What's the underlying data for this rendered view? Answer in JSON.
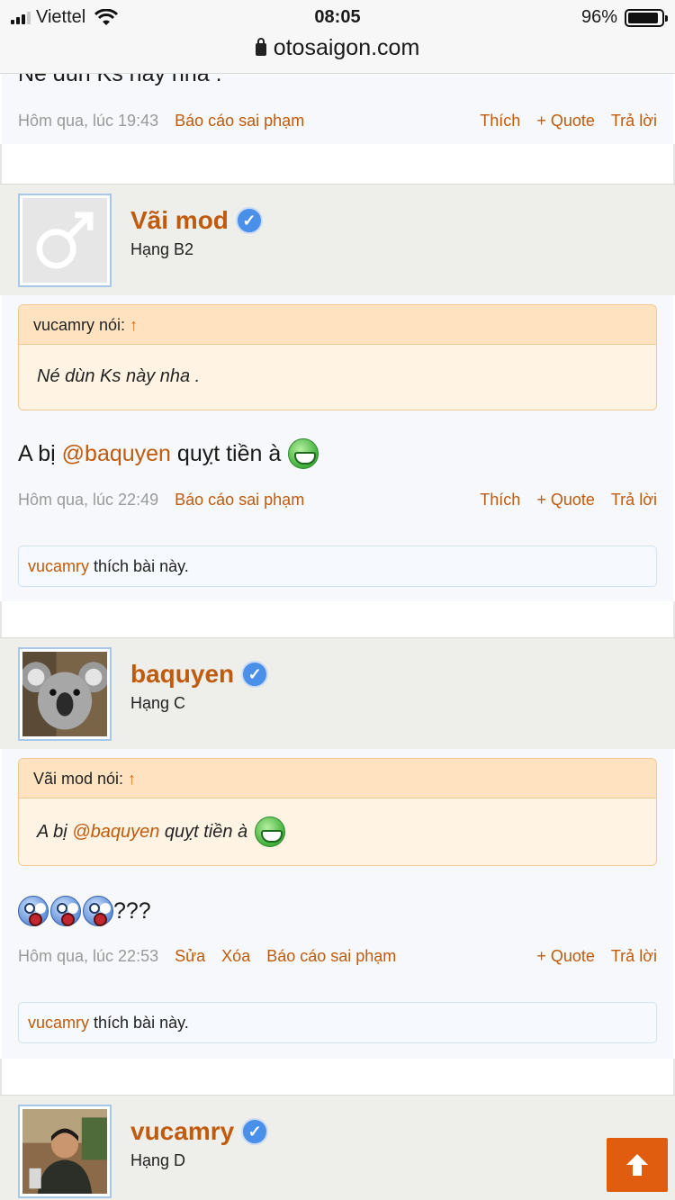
{
  "status_bar": {
    "carrier": "Viettel",
    "time": "08:05",
    "battery": "96%"
  },
  "url_bar": {
    "domain": "otosaigon.com"
  },
  "colors": {
    "accent": "#c05a0c",
    "scroll_button": "#e05d10",
    "quote_bg": "#fff4e4"
  },
  "top_fragment": {
    "text_partial": "Né dùn Ks này nha .",
    "date": "Hôm qua, lúc 19:43",
    "report": "Báo cáo sai phạm",
    "like": "Thích",
    "quote": "+ Quote",
    "reply": "Trả lời"
  },
  "posts": [
    {
      "username": "Vãi mod",
      "rank": "Hạng B2",
      "avatar": "male-symbol-icon",
      "quote": {
        "author": "vucamry nói:",
        "arrow": "↑",
        "text": "Né dùn Ks này nha ."
      },
      "message": {
        "prefix": "A bị ",
        "mention": "@baquyen",
        "suffix": " quỵt tiền à"
      },
      "date": "Hôm qua, lúc 22:49",
      "actions": {
        "report": "Báo cáo sai phạm",
        "like": "Thích",
        "quote": "+ Quote",
        "reply": "Trả lời"
      },
      "likes": {
        "user": "vucamry",
        "text": " thích bài này."
      }
    },
    {
      "username": "baquyen",
      "rank": "Hạng C",
      "avatar": "koala-photo",
      "quote": {
        "author": "Vãi mod nói:",
        "arrow": "↑",
        "text_prefix": "A bị ",
        "mention": "@baquyen",
        "text_suffix": " quỵt tiền à"
      },
      "message": {
        "text": "???"
      },
      "date": "Hôm qua, lúc 22:53",
      "actions": {
        "edit": "Sửa",
        "delete": "Xóa",
        "report": "Báo cáo sai phạm",
        "quote": "+ Quote",
        "reply": "Trả lời"
      },
      "likes": {
        "user": "vucamry",
        "text": " thích bài này."
      }
    },
    {
      "username": "vucamry",
      "rank": "Hạng D",
      "avatar": "person-photo"
    }
  ]
}
